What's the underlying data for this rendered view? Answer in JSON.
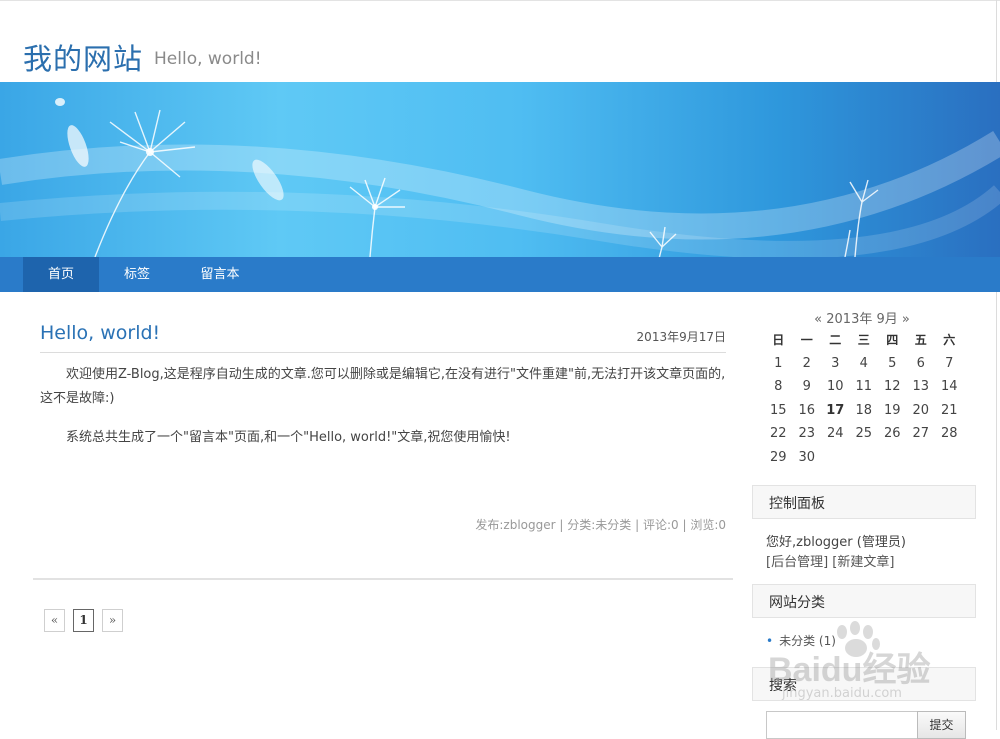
{
  "site": {
    "title": "我的网站",
    "subtitle": "Hello, world!"
  },
  "nav": {
    "items": [
      {
        "label": "首页",
        "active": true
      },
      {
        "label": "标签"
      },
      {
        "label": "留言本"
      }
    ]
  },
  "post": {
    "title": "Hello, world!",
    "date": "2013年9月17日",
    "paragraphs": [
      "欢迎使用Z-Blog,这是程序自动生成的文章.您可以删除或是编辑它,在没有进行\"文件重建\"前,无法打开该文章页面的,这不是故障:)",
      "系统总共生成了一个\"留言本\"页面,和一个\"Hello, world!\"文章,祝您使用愉快!"
    ],
    "meta": "发布:zblogger | 分类:未分类 | 评论:0 | 浏览:0"
  },
  "pager": {
    "prev": "«",
    "current": "1",
    "next": "»"
  },
  "calendar": {
    "prev": "«",
    "title": "2013年 9月",
    "next": "»",
    "weekdays": [
      "日",
      "一",
      "二",
      "三",
      "四",
      "五",
      "六"
    ],
    "weeks": [
      [
        "1",
        "2",
        "3",
        "4",
        "5",
        "6",
        "7"
      ],
      [
        "8",
        "9",
        "10",
        "11",
        "12",
        "13",
        "14"
      ],
      [
        "15",
        "16",
        "17",
        "18",
        "19",
        "20",
        "21"
      ],
      [
        "22",
        "23",
        "24",
        "25",
        "26",
        "27",
        "28"
      ],
      [
        "29",
        "30",
        "",
        "",
        "",
        "",
        ""
      ]
    ],
    "today": "17"
  },
  "control_panel": {
    "title": "控制面板",
    "greeting": "您好,zblogger (管理员)",
    "admin_link": "[后台管理]",
    "new_post_link": "[新建文章]"
  },
  "categories": {
    "title": "网站分类",
    "items": [
      {
        "label": "未分类 (1)"
      }
    ]
  },
  "search": {
    "title": "搜索",
    "button": "提交",
    "placeholder": ""
  },
  "watermark": {
    "brand": "Baidu经验",
    "url": "jingyan.baidu.com"
  },
  "colors": {
    "nav_bg": "#2a7bc9",
    "nav_active": "#1e64ad",
    "title_blue": "#2b6fae"
  }
}
